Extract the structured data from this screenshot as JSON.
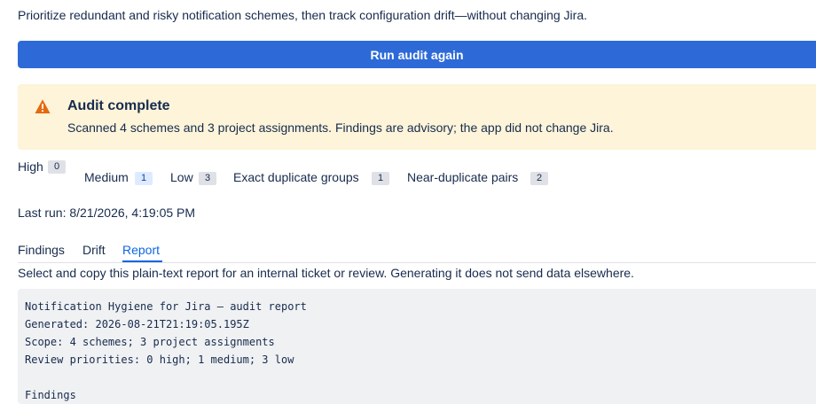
{
  "intro": "Prioritize redundant and risky notification schemes, then track configuration drift—without changing Jira.",
  "run_button": "Run audit again",
  "banner": {
    "icon": "warning-icon",
    "color": "#fdf4d9",
    "icon_color": "#e56910",
    "title": "Audit complete",
    "text": "Scanned 4 schemes and 3 project assignments. Findings are advisory; the app did not change Jira."
  },
  "stats": {
    "high_label": "High",
    "high_count": "0",
    "medium_label": "Medium",
    "medium_count": "1",
    "low_label": "Low",
    "low_count": "3",
    "exact_label": "Exact duplicate groups",
    "exact_count": "1",
    "near_label": "Near-duplicate pairs",
    "near_count": "2"
  },
  "last_run": "Last run: 8/21/2026, 4:19:05 PM",
  "tabs": [
    {
      "label": "Findings",
      "active": false
    },
    {
      "label": "Drift",
      "active": false
    },
    {
      "label": "Report",
      "active": true
    }
  ],
  "report_hint": "Select and copy this plain-text report for an internal ticket or review. Generating it does not send data elsewhere.",
  "report_lines": [
    "Notification Hygiene for Jira — audit report",
    "Generated: 2026-08-21T21:19:05.195Z",
    "Scope: 4 schemes; 3 project assignments",
    "Review priorities: 0 high; 1 medium; 3 low",
    "",
    "Findings"
  ],
  "colors": {
    "primary": "#2d6ad8",
    "tab_active": "#0c66e4"
  }
}
